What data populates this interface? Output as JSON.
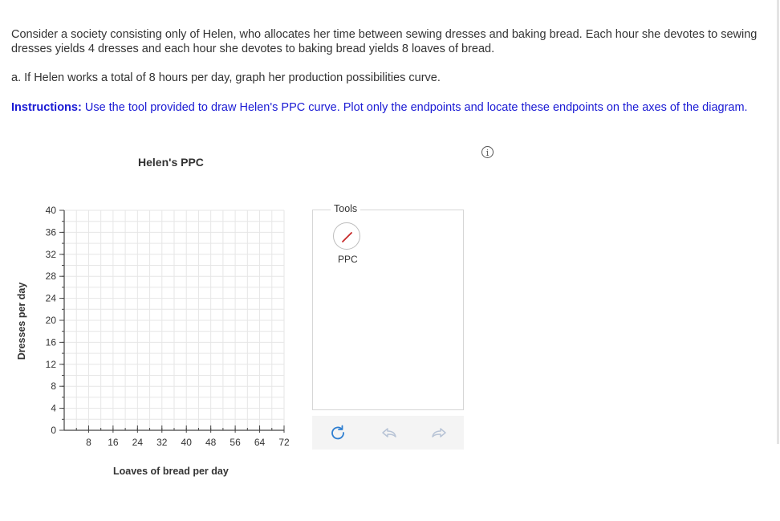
{
  "question": {
    "intro": "Consider a society consisting only of Helen, who allocates her time between sewing dresses and baking bread. Each hour she devotes to sewing dresses yields 4 dresses and each hour she devotes to baking bread yields 8 loaves of bread.",
    "part_a": "a. If Helen works a total of 8 hours per day, graph her production possibilities curve.",
    "instructions_label": "Instructions:",
    "instructions_text": " Use the tool provided to draw Helen's PPC curve. Plot only the endpoints and locate these endpoints on the axes of the diagram."
  },
  "info_icon": {
    "icon": "info-icon",
    "glyph": "i"
  },
  "chart_data": {
    "type": "scatter",
    "title": "Helen's PPC",
    "xlabel": "Loaves of bread per day",
    "ylabel": "Dresses per day",
    "xlim": [
      0,
      72
    ],
    "ylim": [
      0,
      40
    ],
    "x_ticks": [
      8,
      16,
      24,
      32,
      40,
      48,
      56,
      64,
      72
    ],
    "y_ticks": [
      0,
      4,
      8,
      12,
      16,
      20,
      24,
      28,
      32,
      36,
      40
    ],
    "x_minor_step": 4,
    "y_minor_step": 2,
    "grid": true,
    "series": []
  },
  "tools": {
    "label": "Tools",
    "items": [
      {
        "label": "PPC",
        "icon": "line-draw-icon",
        "color": "#c62828"
      }
    ],
    "toolbar": [
      {
        "icon": "reset-icon",
        "color": "#2f7fd1"
      },
      {
        "icon": "undo-icon",
        "color": "#b8c4d6"
      },
      {
        "icon": "redo-icon",
        "color": "#b8c4d6"
      }
    ]
  }
}
